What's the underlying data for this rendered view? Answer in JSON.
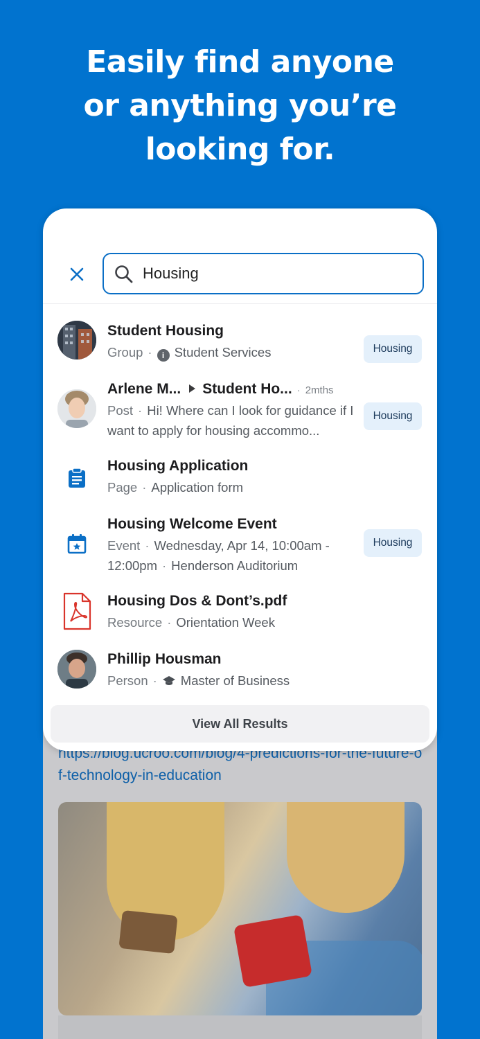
{
  "headline": {
    "line1": "Easily find anyone",
    "line2": "or anything you’re",
    "line3": "looking for."
  },
  "search": {
    "value": "Housing",
    "close_icon": "close-icon",
    "search_icon": "search-icon"
  },
  "results": [
    {
      "title": "Student Housing",
      "type": "Group",
      "detail": "Student Services",
      "detail_icon": "info-icon",
      "badge": "Housing",
      "leading": "avatar-building"
    },
    {
      "author": "Arlene M...",
      "target": "Student Ho...",
      "time": "2mths",
      "type": "Post",
      "detail": "Hi! Where can I look for guidance if I want to apply for housing accommo...",
      "badge": "Housing",
      "leading": "avatar-person"
    },
    {
      "title": "Housing Application",
      "type": "Page",
      "detail": "Application form",
      "leading": "clipboard-icon"
    },
    {
      "title": "Housing Welcome Event",
      "type": "Event",
      "detail": "Wednesday, Apr 14, 10:00am - 12:00pm",
      "location": "Henderson Auditorium",
      "badge": "Housing",
      "leading": "calendar-star-icon"
    },
    {
      "title": "Housing Dos & Dont’s.pdf",
      "type": "Resource",
      "detail": "Orientation Week",
      "leading": "pdf-icon"
    },
    {
      "title": "Phillip Housman",
      "type": "Person",
      "detail": "Master of Business",
      "detail_icon": "graduation-cap-icon",
      "leading": "avatar-person"
    }
  ],
  "view_all_label": "View All Results",
  "feed": {
    "link": "https://blog.ucroo.com/blog/4-predictions-for-the-future-of-technology-in-education"
  },
  "colors": {
    "background": "#0173cf",
    "accent": "#0b6fc6",
    "badge_bg": "#e4f0fb",
    "pdf_red": "#d9342b"
  }
}
